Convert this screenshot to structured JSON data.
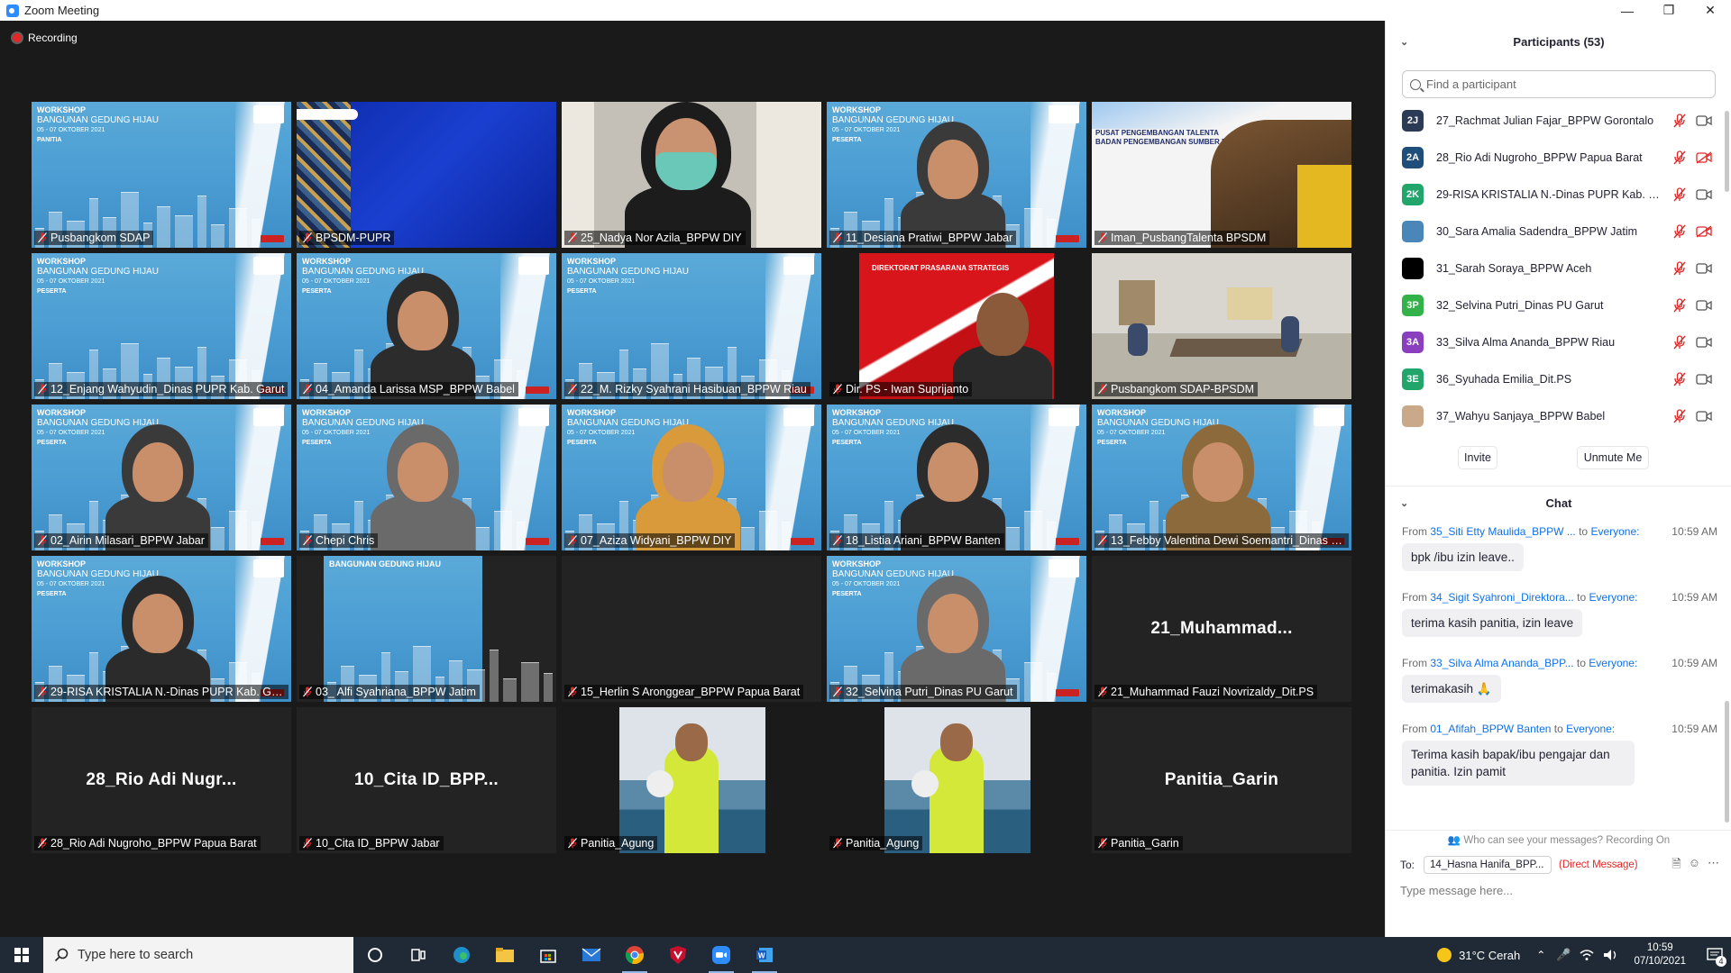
{
  "window": {
    "title": "Zoom Meeting",
    "controls": [
      "—",
      "❐",
      "✕"
    ]
  },
  "meeting": {
    "recording_label": "Recording",
    "tiles": [
      {
        "label": "Pusbangkom SDAP",
        "kind": "workshop",
        "role": "PANITIA"
      },
      {
        "label": "BPSDM-PUPR",
        "kind": "blue"
      },
      {
        "label": "25_Nadya Nor Azila_BPPW DIY",
        "kind": "mask"
      },
      {
        "label": "11_Desiana Pratiwi_BPPW Jabar",
        "kind": "workshop-person"
      },
      {
        "label": "Iman_PusbangTalenta BPSDM",
        "kind": "talenta"
      },
      {
        "label": "12_Enjang Wahyudin_Dinas PUPR Kab. Garut",
        "kind": "workshop"
      },
      {
        "label": "04_Amanda Larissa MSP_BPPW Babel",
        "kind": "workshop-person"
      },
      {
        "label": "22_M. Rizky Syahrani Hasibuan_BPPW Riau",
        "kind": "workshop"
      },
      {
        "label": "Dir. PS - Iwan Suprijanto",
        "kind": "red"
      },
      {
        "label": "Pusbangkom SDAP-BPSDM",
        "kind": "room"
      },
      {
        "label": "02_Airin Milasari_BPPW Jabar",
        "kind": "workshop-person"
      },
      {
        "label": "Chepi Chris",
        "kind": "workshop-person"
      },
      {
        "label": "07_Aziza Widyani_BPPW DIY",
        "kind": "workshop-person"
      },
      {
        "label": "18_Listia Ariani_BPPW Banten",
        "kind": "workshop-person"
      },
      {
        "label": "13_Febby Valentina Dewi Soemantri_Dinas P...",
        "kind": "workshop-person"
      },
      {
        "label": "29-RISA KRISTALIA N.-Dinas PUPR Kab. Garut",
        "kind": "workshop-person"
      },
      {
        "label": "03_ Alfi Syahriana_BPPW Jatim",
        "kind": "workshop-narrow"
      },
      {
        "label": "15_Herlin S Aronggear_BPPW Papua Barat",
        "kind": "empty"
      },
      {
        "label": "32_Selvina Putri_Dinas PU Garut",
        "kind": "workshop-person"
      },
      {
        "label": "21_Muhammad Fauzi Novrizaldy_Dit.PS",
        "kind": "name",
        "center": "21_Muhammad..."
      },
      {
        "label": "28_Rio Adi Nugroho_BPPW Papua Barat",
        "kind": "name",
        "center": "28_Rio Adi Nugr..."
      },
      {
        "label": "10_Cita ID_BPPW Jabar",
        "kind": "name",
        "center": "10_Cita ID_BPP..."
      },
      {
        "label": "Panitia_Agung",
        "kind": "photo"
      },
      {
        "label": "Panitia_Agung",
        "kind": "photo"
      },
      {
        "label": "Panitia_Garin",
        "kind": "name",
        "center": "Panitia_Garin"
      }
    ],
    "workshop_text": {
      "line1": "WORKSHOP",
      "line2": "BANGUNAN GEDUNG HIJAU",
      "line3": "05 - 07 OKTOBER 2021",
      "role": "PESERTA"
    },
    "talenta_text": {
      "line1": "PUSAT PENGEMBANGAN TALENTA",
      "line2": "BADAN PENGEMBANGAN SUMBER DAYA MANUSIA"
    },
    "red_text": "DIREKTORAT PRASARANA STRATEGIS"
  },
  "participants": {
    "header": "Participants (53)",
    "search_placeholder": "Find a participant",
    "items": [
      {
        "initials": "2J",
        "color": "#2b3a55",
        "name": "27_Rachmat Julian Fajar_BPPW Gorontalo",
        "cam_off": false
      },
      {
        "initials": "2A",
        "color": "#1f4e7a",
        "name": "28_Rio Adi Nugroho_BPPW Papua Barat",
        "cam_off": true
      },
      {
        "initials": "2K",
        "color": "#22a56b",
        "name": "29-RISA KRISTALIA N.-Dinas PUPR Kab. Gar...",
        "cam_off": false
      },
      {
        "initials": "",
        "color": "#4a86b8",
        "name": "30_Sara Amalia Sadendra_BPPW Jatim",
        "cam_off": true
      },
      {
        "initials": "",
        "color": "#000000",
        "name": "31_Sarah Soraya_BPPW Aceh",
        "cam_off": false
      },
      {
        "initials": "3P",
        "color": "#33b24a",
        "name": "32_Selvina Putri_Dinas PU Garut",
        "cam_off": false
      },
      {
        "initials": "3A",
        "color": "#8a3fbf",
        "name": "33_Silva Alma Ananda_BPPW Riau",
        "cam_off": false
      },
      {
        "initials": "3E",
        "color": "#22a56b",
        "name": "36_Syuhada Emilia_Dit.PS",
        "cam_off": false
      },
      {
        "initials": "",
        "color": "#c9a98a",
        "name": "37_Wahyu Sanjaya_BPPW Babel",
        "cam_off": false
      }
    ],
    "invite_label": "Invite",
    "unmute_label": "Unmute Me"
  },
  "chat": {
    "header": "Chat",
    "from_label": "From",
    "to_label": "to",
    "messages": [
      {
        "sender": "35_Siti Etty Maulida_BPPW ...",
        "target": "Everyone:",
        "time": "10:59 AM",
        "text": "bpk /ibu izin leave.."
      },
      {
        "sender": "34_Sigit Syahroni_Direktora...",
        "target": "Everyone:",
        "time": "10:59 AM",
        "text": "terima kasih panitia, izin leave"
      },
      {
        "sender": "33_Silva Alma Ananda_BPP...",
        "target": "Everyone:",
        "time": "10:59 AM",
        "text": "terimakasih 🙏"
      },
      {
        "sender": "01_Afifah_BPPW Banten",
        "target": "Everyone:",
        "time": "10:59 AM",
        "text": "Terima kasih bapak/ibu pengajar dan panitia. Izin pamit"
      }
    ],
    "notice": "Who can see your messages? Recording On",
    "to_prefix": "To:",
    "to_value": "14_Hasna Hanifa_BPP...",
    "direct_message": "(Direct Message)",
    "input_placeholder": "Type message here..."
  },
  "taskbar": {
    "search_placeholder": "Type here to search",
    "weather": "31°C  Cerah",
    "time": "10:59",
    "date": "07/10/2021",
    "notifications": "4"
  }
}
